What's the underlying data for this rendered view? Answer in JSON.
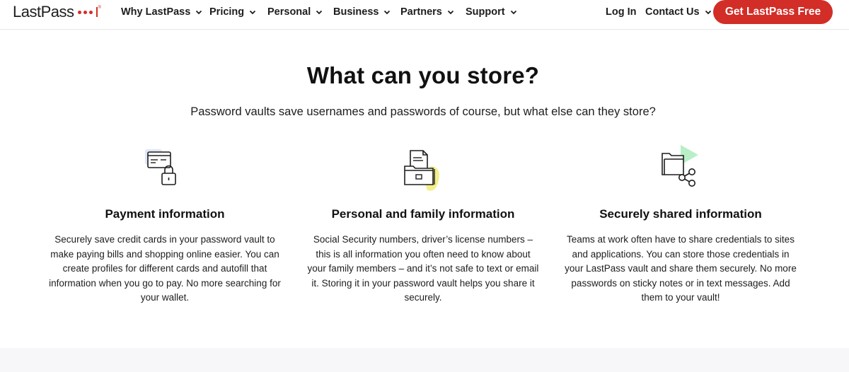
{
  "brand": {
    "logo_text": "LastPass",
    "logo_reg": "®",
    "accent_color": "#d32d27"
  },
  "nav": {
    "items": [
      {
        "label": "Why LastPass",
        "icon": "chevron-down-icon"
      },
      {
        "label": "Pricing",
        "icon": "chevron-down-icon"
      },
      {
        "label": "Personal",
        "icon": "chevron-down-icon"
      },
      {
        "label": "Business",
        "icon": "chevron-down-icon"
      },
      {
        "label": "Partners",
        "icon": "chevron-down-icon"
      },
      {
        "label": "Support",
        "icon": "chevron-down-icon"
      }
    ],
    "login_label": "Log In",
    "contact_label": "Contact Us",
    "cta_label": "Get LastPass Free"
  },
  "main": {
    "heading": "What can you store?",
    "subheading": "Password vaults save usernames and passwords of course, but what else can they store?",
    "cards": [
      {
        "icon": "credit-card-lock-icon",
        "title": "Payment information",
        "body": "Securely save credit cards in your password vault to make paying bills and shopping online easier. You can create profiles for different cards and autofill that information when you go to pay. No more searching for your wallet."
      },
      {
        "icon": "document-folder-icon",
        "title": "Personal and family information",
        "body": "Social Security numbers, driver’s license numbers – this is all information you often need to know about your family members – and it’s not safe to text or email it. Storing it in your password vault helps you share it securely."
      },
      {
        "icon": "shared-folder-icon",
        "title": "Securely shared information",
        "body": "Teams at work often have to share credentials to sites and applications. You can store those credentials in your LastPass vault and share them securely. No more passwords on sticky notes or in text messages. Add them to your vault!"
      }
    ]
  }
}
